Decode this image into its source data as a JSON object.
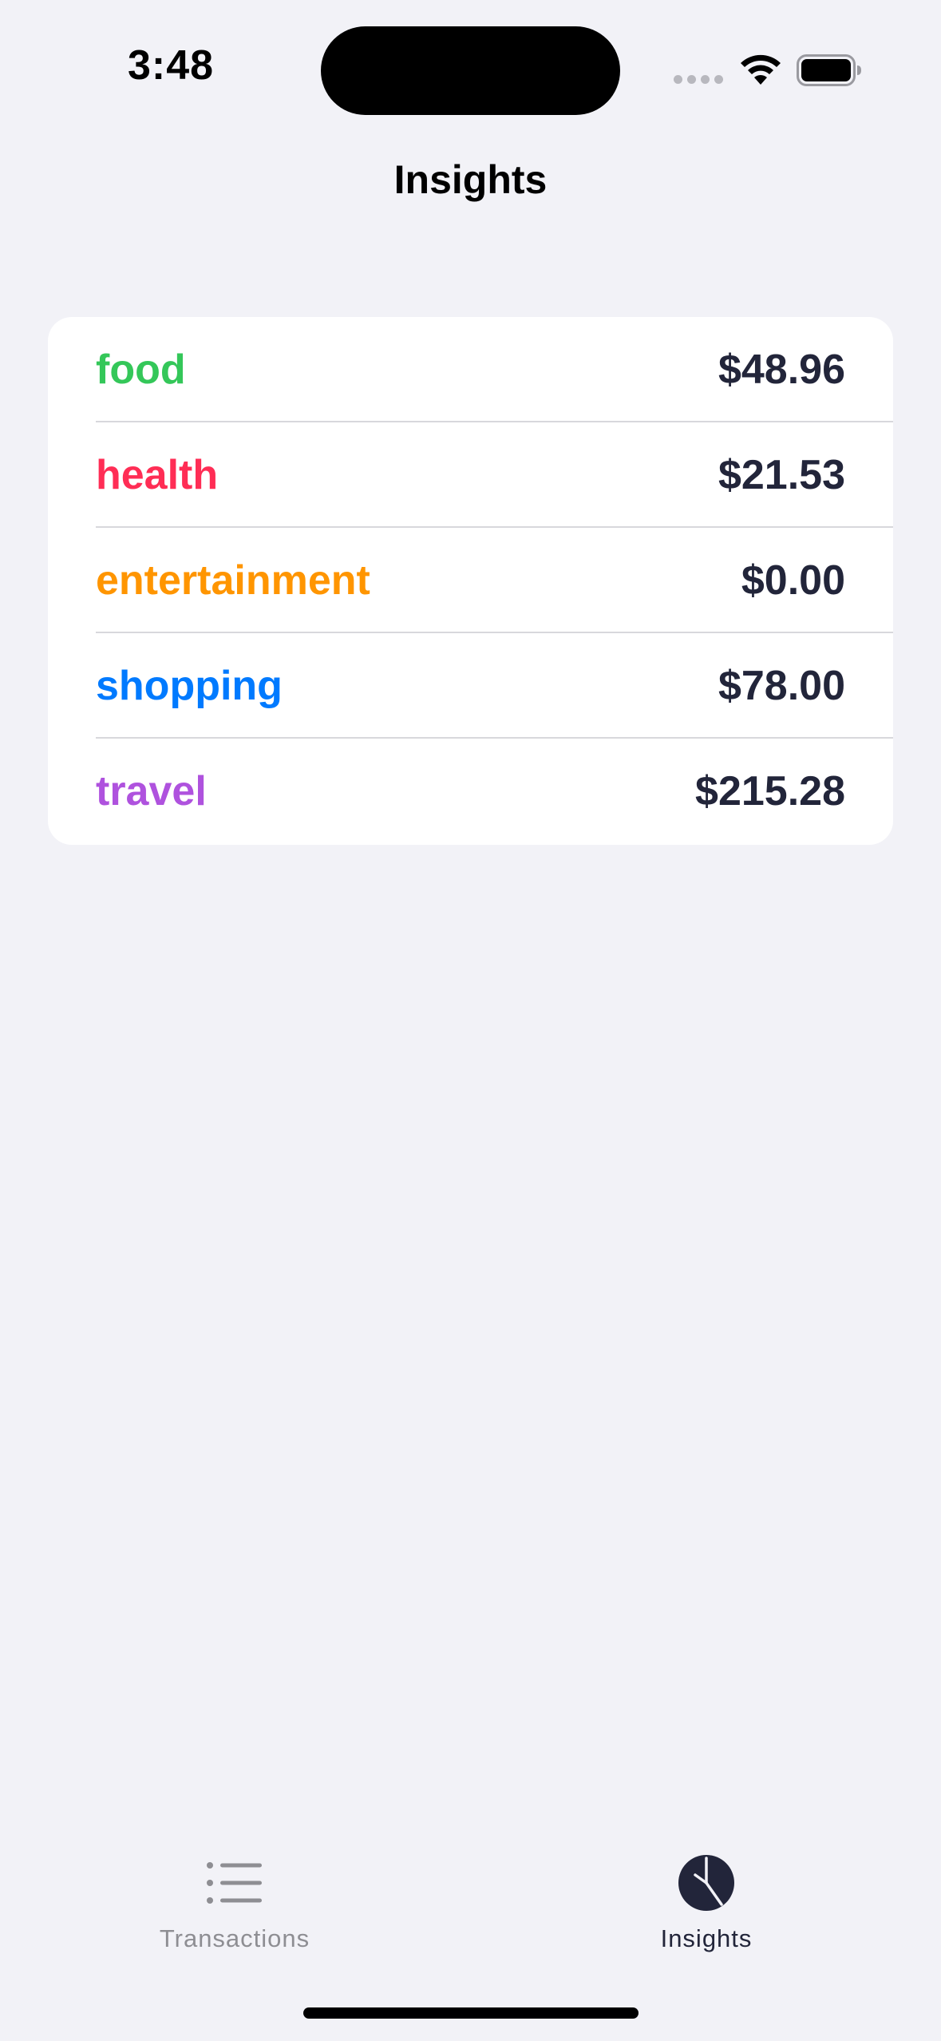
{
  "status_bar": {
    "time": "3:48"
  },
  "nav": {
    "title": "Insights"
  },
  "insights": {
    "rows": [
      {
        "category": "food",
        "amount": "$48.96",
        "color": "#34c759"
      },
      {
        "category": "health",
        "amount": "$21.53",
        "color": "#ff2d55"
      },
      {
        "category": "entertainment",
        "amount": "$0.00",
        "color": "#ff9500"
      },
      {
        "category": "shopping",
        "amount": "$78.00",
        "color": "#007aff"
      },
      {
        "category": "travel",
        "amount": "$215.28",
        "color": "#af52de"
      }
    ]
  },
  "tab_bar": {
    "tabs": [
      {
        "label": "Transactions",
        "icon": "list-bullet-icon",
        "selected": false
      },
      {
        "label": "Insights",
        "icon": "pie-chart-icon",
        "selected": true
      }
    ]
  },
  "colors": {
    "background": "#f2f2f7",
    "card": "#ffffff",
    "amount_text": "#22253a",
    "tab_inactive": "#8e8e93",
    "tab_active": "#22253a"
  }
}
